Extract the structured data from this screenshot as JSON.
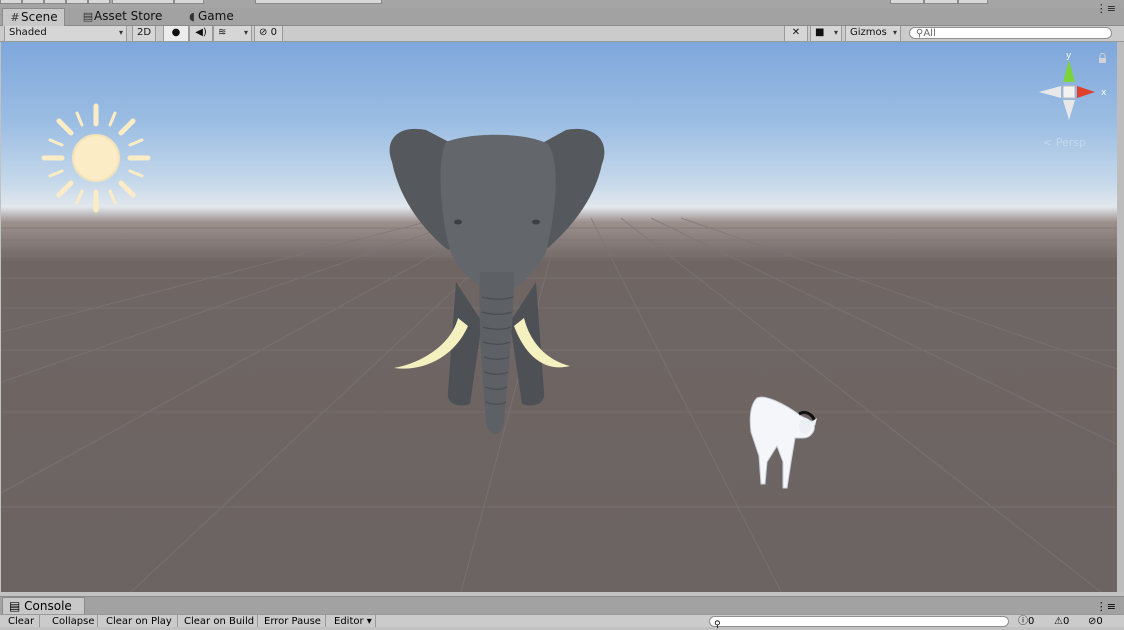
{
  "tabs": [
    {
      "label": "Scene",
      "icon": "grid-icon",
      "active": true
    },
    {
      "label": "Asset Store",
      "icon": "store-icon",
      "active": false
    },
    {
      "label": "Game",
      "icon": "pacman-icon",
      "active": false
    }
  ],
  "toolbar": {
    "draw_mode": "Shaded",
    "mode_2d": "2D",
    "lighting_icon": "lightbulb-icon",
    "audio_icon": "speaker-icon",
    "effects_icon": "layers-icon",
    "hidden_count": "0",
    "tools_icon": "tools-icon",
    "camera_icon": "camera-icon",
    "gizmos_label": "Gizmos",
    "search_placeholder": "All"
  },
  "scene": {
    "objects": [
      "sun-light-gizmo",
      "elephant",
      "goat"
    ],
    "gizmo_axes": {
      "y": "y",
      "x": "x"
    },
    "persp_label": "< Persp"
  },
  "console": {
    "tab_label": "Console",
    "buttons": [
      "Clear",
      "Collapse",
      "Clear on Play",
      "Clear on Build",
      "Error Pause",
      "Editor"
    ],
    "counts": {
      "info": "0",
      "warnings": "0",
      "errors": "0"
    }
  },
  "colors": {
    "sky_top": "#7ea7db",
    "ground": "#6c6462",
    "elephant": "#5f6266",
    "tusk": "#f5f0bf",
    "sun": "#fbecc6",
    "gizmo_x": "#e0412d",
    "gizmo_y": "#7cd23a"
  }
}
